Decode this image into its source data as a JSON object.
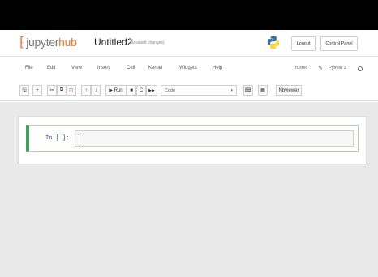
{
  "header": {
    "logo_brace": "⁅",
    "logo_part1": "jupyter",
    "logo_part2": "hub",
    "notebook_title": "Untitled2",
    "notebook_status": "(unsaved changes)",
    "logout_label": "Logout",
    "control_panel_label": "Control Panel"
  },
  "menubar": {
    "items": [
      "File",
      "Edit",
      "View",
      "Insert",
      "Cell",
      "Kernel",
      "Widgets",
      "Help"
    ],
    "trusted_label": "Trusted",
    "edit_glyph": "✎",
    "kernel_name": "Python 3"
  },
  "toolbar": {
    "save_glyph": "🖫",
    "add_glyph": "+",
    "cut_glyph": "✂",
    "copy_glyph": "⧉",
    "paste_glyph": "📋",
    "up_glyph": "↑",
    "down_glyph": "↓",
    "run_label": "▶ Run",
    "interrupt_glyph": "■",
    "restart_glyph": "C",
    "restart_run_glyph": "▶▶",
    "celltype_value": "Code",
    "keyboard_glyph": "⌨",
    "chart_glyph": "▦",
    "nbviewer_label": "Nbviewer"
  },
  "cell": {
    "prompt": "In [ ]:",
    "source": "",
    "line_number": "1"
  },
  "colors": {
    "accent": "#f37626",
    "cell_border_active": "#42a05a",
    "background": "#e9e9e9"
  }
}
